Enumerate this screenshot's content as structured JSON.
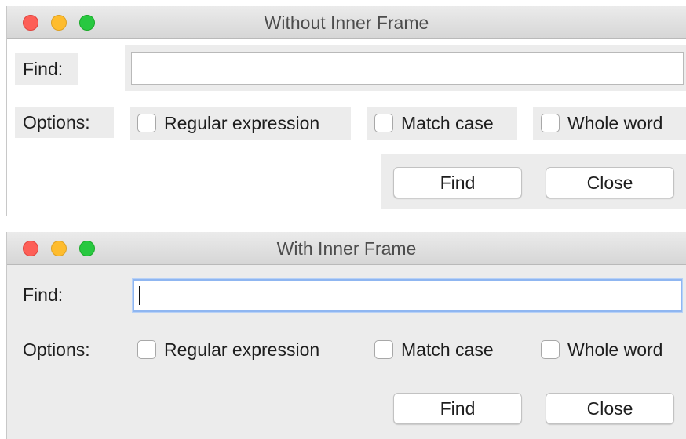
{
  "windows": [
    {
      "title": "Without Inner Frame",
      "find_label": "Find:",
      "find_value": "",
      "options_label": "Options:",
      "options": [
        {
          "label": "Regular expression",
          "checked": false
        },
        {
          "label": "Match case",
          "checked": false
        },
        {
          "label": "Whole word",
          "checked": false
        }
      ],
      "buttons": {
        "find": "Find",
        "close": "Close"
      }
    },
    {
      "title": "With Inner Frame",
      "find_label": "Find:",
      "find_value": "",
      "options_label": "Options:",
      "options": [
        {
          "label": "Regular expression",
          "checked": false
        },
        {
          "label": "Match case",
          "checked": false
        },
        {
          "label": "Whole word",
          "checked": false
        }
      ],
      "buttons": {
        "find": "Find",
        "close": "Close"
      }
    }
  ],
  "colors": {
    "traffic_close": "#fd5f57",
    "traffic_minimize": "#febc2e",
    "traffic_maximize": "#28c840",
    "focus_ring": "#8fb6f1"
  }
}
